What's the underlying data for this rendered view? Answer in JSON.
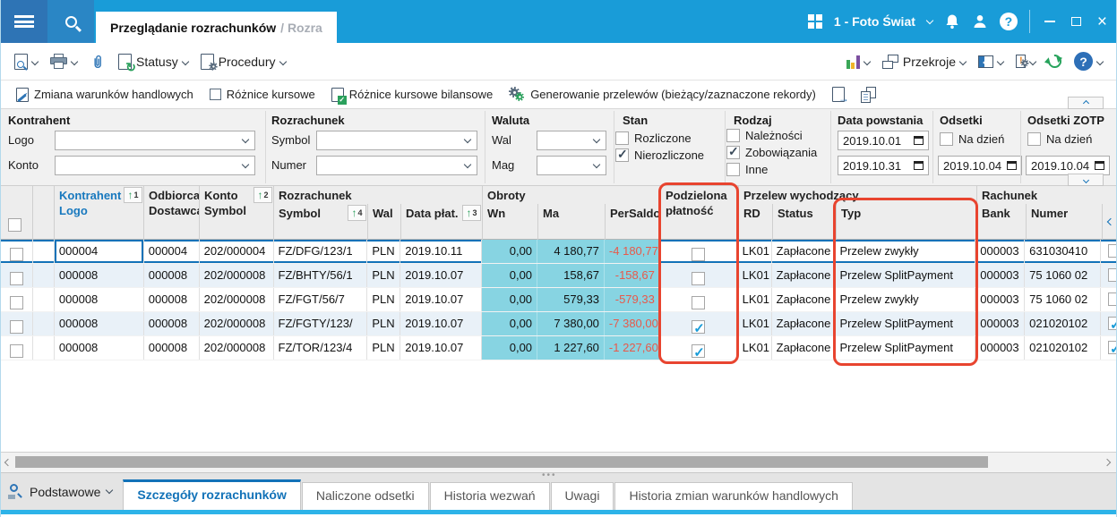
{
  "window": {
    "tab_title": "Przeglądanie rozrachunków",
    "tab_title_faded": "/ Rozra",
    "company": "1 - Foto Świat"
  },
  "toolbar_top": {
    "statusy_label": "Statusy",
    "procedury_label": "Procedury",
    "przekroje_label": "Przekroje"
  },
  "actions_bar": {
    "zmiana_label": "Zmiana warunków handlowych",
    "roznice_label": "Różnice kursowe",
    "roznice_bilansowe_label": "Różnice kursowe bilansowe",
    "generowanie_label": "Generowanie przelewów (bieżący/zaznaczone rekordy)"
  },
  "filters": {
    "kontrahent": {
      "title": "Kontrahent",
      "logo_label": "Logo",
      "logo_value": "",
      "konto_label": "Konto",
      "konto_value": ""
    },
    "rozrachunek": {
      "title": "Rozrachunek",
      "symbol_label": "Symbol",
      "symbol_value": "",
      "numer_label": "Numer",
      "numer_value": ""
    },
    "waluta": {
      "title": "Waluta",
      "wal_label": "Wal",
      "wal_value": "",
      "mag_label": "Mag",
      "mag_value": ""
    },
    "stan": {
      "title": "Stan",
      "rozliczone_label": "Rozliczone",
      "rozliczone_checked": false,
      "nierozliczone_label": "Nierozliczone",
      "nierozliczone_checked": true
    },
    "rodzaj": {
      "title": "Rodzaj",
      "naleznosci_label": "Należności",
      "naleznosci_checked": false,
      "zobowiazania_label": "Zobowiązania",
      "zobowiazania_checked": true,
      "inne_label": "Inne",
      "inne_checked": false
    },
    "data_powstania": {
      "title": "Data powstania",
      "date_from": "2019.10.01",
      "date_to": "2019.10.31"
    },
    "odsetki": {
      "title": "Odsetki",
      "na_dzien_label": "Na dzień",
      "na_dzien_checked": false,
      "date": "2019.10.04"
    },
    "odsetki_zotp": {
      "title": "Odsetki ZOTP",
      "na_dzien_label": "Na dzień",
      "na_dzien_checked": false,
      "date": "2019.10.04"
    }
  },
  "table": {
    "header": {
      "kontrahent": "Kontrahent",
      "logo": "Logo",
      "sort_kontrahent": "1",
      "odbiorca": "Odbiorca",
      "dostawca": "Dostawca",
      "konto": "Konto",
      "konto_symbol": "Symbol",
      "sort_konto": "2",
      "rozrachunek_group": "Rozrachunek",
      "symbol": "Symbol",
      "sort_symbol": "4",
      "wal": "Wal",
      "data_plat": "Data płat.",
      "sort_data_plat": "3",
      "obroty_group": "Obroty",
      "wn": "Wn",
      "ma": "Ma",
      "persaldo": "PerSaldo",
      "podzielona_line1": "Podzielona",
      "podzielona_line2": "płatność",
      "przelew_group": "Przelew wychodzący",
      "rd": "RD",
      "status": "Status",
      "typ": "Typ",
      "rachunek_group": "Rachunek",
      "bank": "Bank",
      "numer": "Numer"
    },
    "rows": [
      {
        "logo": "000004",
        "odbiorca": "000004",
        "konto": "202/000004",
        "symbol": "FZ/DFG/123/1",
        "wal": "PLN",
        "data_plat": "2019.10.11",
        "wn": "0,00",
        "ma": "4 180,77",
        "persaldo": "-4 180,77",
        "podzielona": false,
        "rd": "LK01",
        "status": "Zapłacone",
        "typ": "Przelew zwykły",
        "bank": "000003",
        "numer": "631030410",
        "selected": true
      },
      {
        "logo": "000008",
        "odbiorca": "000008",
        "konto": "202/000008",
        "symbol": "FZ/BHTY/56/1",
        "wal": "PLN",
        "data_plat": "2019.10.07",
        "wn": "0,00",
        "ma": "158,67",
        "persaldo": "-158,67",
        "podzielona": false,
        "rd": "LK01",
        "status": "Zapłacone",
        "typ": "Przelew SplitPayment",
        "bank": "000003",
        "numer": "75 1060 02",
        "selected": false
      },
      {
        "logo": "000008",
        "odbiorca": "000008",
        "konto": "202/000008",
        "symbol": "FZ/FGT/56/7",
        "wal": "PLN",
        "data_plat": "2019.10.07",
        "wn": "0,00",
        "ma": "579,33",
        "persaldo": "-579,33",
        "podzielona": false,
        "rd": "LK01",
        "status": "Zapłacone",
        "typ": "Przelew zwykły",
        "bank": "000003",
        "numer": "75 1060 02",
        "selected": false
      },
      {
        "logo": "000008",
        "odbiorca": "000008",
        "konto": "202/000008",
        "symbol": "FZ/FGTY/123/",
        "wal": "PLN",
        "data_plat": "2019.10.07",
        "wn": "0,00",
        "ma": "7 380,00",
        "persaldo": "-7 380,00",
        "podzielona": true,
        "rd": "LK01",
        "status": "Zapłacone",
        "typ": "Przelew SplitPayment",
        "bank": "000003",
        "numer": "021020102",
        "selected": false
      },
      {
        "logo": "000008",
        "odbiorca": "000008",
        "konto": "202/000008",
        "symbol": "FZ/TOR/123/4",
        "wal": "PLN",
        "data_plat": "2019.10.07",
        "wn": "0,00",
        "ma": "1 227,60",
        "persaldo": "-1 227,60",
        "podzielona": true,
        "rd": "LK01",
        "status": "Zapłacone",
        "typ": "Przelew SplitPayment",
        "bank": "000003",
        "numer": "021020102",
        "selected": false
      }
    ]
  },
  "bottom_tabs": {
    "podstawowe_label": "Podstawowe",
    "tabs": [
      {
        "label": "Szczegóły rozrachunków",
        "active": true
      },
      {
        "label": "Naliczone odsetki",
        "active": false
      },
      {
        "label": "Historia wezwań",
        "active": false
      },
      {
        "label": "Uwagi",
        "active": false
      },
      {
        "label": "Historia zmian warunków handlowych",
        "active": false
      }
    ]
  },
  "colors": {
    "titlebar": "#199cd8",
    "hamburger": "#2e74b5",
    "accent_blue": "#1272b8",
    "cyan_column": "#87d4e2",
    "negative": "#e8594a",
    "annotation": "#e8442f",
    "green_icon": "#2aa05c",
    "sorted_header_text": "#1778be"
  }
}
